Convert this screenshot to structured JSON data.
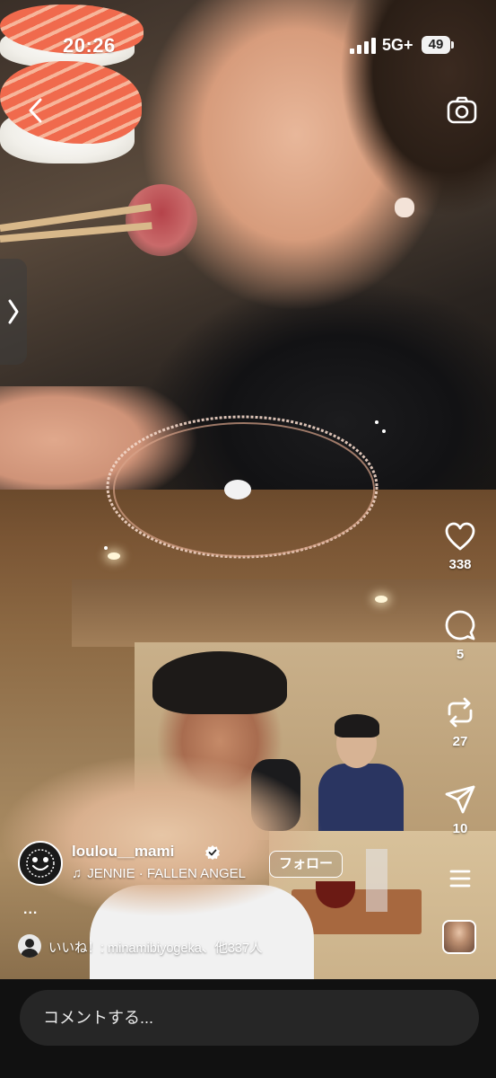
{
  "status_bar": {
    "time": "20:26",
    "network": "5G+",
    "battery": "49"
  },
  "reel": {
    "username": "loulou__mami",
    "verified": true,
    "music": "JENNIE · FALLEN ANGEL",
    "follow_label": "フォロー",
    "caption_more": "...",
    "likes_text": "いいね！: minamibiyogeka、他337人"
  },
  "actions": {
    "like_count": "338",
    "comment_count": "5",
    "repost_count": "27",
    "share_count": "10"
  },
  "comment": {
    "placeholder": "コメントする..."
  },
  "icons": {
    "back": "chevron-left-icon",
    "camera": "camera-icon",
    "side_tab": "chevron-right-icon",
    "like": "heart-icon",
    "comment": "comment-bubble-icon",
    "repost": "repost-icon",
    "share": "paper-plane-icon",
    "more": "more-icon",
    "music": "music-note-icon",
    "verified": "verified-badge-icon"
  },
  "colors": {
    "background": "#000000",
    "comment_bar": "#111111",
    "comment_input": "#262626",
    "verified": "#ffffff"
  }
}
